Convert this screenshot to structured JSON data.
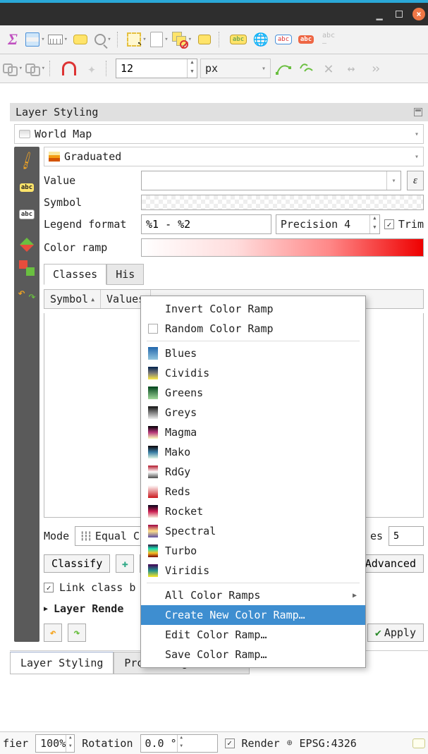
{
  "toolbar2": {
    "size_value": "12",
    "unit": "px"
  },
  "panel": {
    "title": "Layer Styling",
    "layer": "World Map",
    "renderer": "Graduated",
    "value_label": "Value",
    "symbol_label": "Symbol",
    "legend_label": "Legend format",
    "legend_value": "%1 - %2",
    "precision": "Precision 4",
    "trim_label": "Trim",
    "ramp_label": "Color ramp",
    "tabs": {
      "classes": "Classes",
      "histogram": "His"
    },
    "columns": {
      "symbol": "Symbol",
      "values": "Values"
    },
    "mode_label": "Mode",
    "mode_value": "Equal C",
    "classes_label": "es",
    "classes_value": "5",
    "classify": "Classify",
    "advanced": "Advanced",
    "link": "Link class b",
    "layer_rendering": "Layer Rende",
    "apply": "Apply"
  },
  "bottom_tabs": {
    "styling": "Layer Styling",
    "toolbox": "Processing Toolbox"
  },
  "status": {
    "field_label": "fier",
    "field_value": "100%",
    "rotation_label": "Rotation",
    "rotation_value": "0.0 °",
    "render": "Render",
    "crs": "EPSG:4326"
  },
  "menu": {
    "invert": "Invert Color Ramp",
    "random": "Random Color Ramp",
    "ramps": [
      "Blues",
      "Cividis",
      "Greens",
      "Greys",
      "Magma",
      "Mako",
      "RdGy",
      "Reds",
      "Rocket",
      "Spectral",
      "Turbo",
      "Viridis"
    ],
    "all": "All Color Ramps",
    "create": "Create New Color Ramp…",
    "edit": "Edit Color Ramp…",
    "save": "Save Color Ramp…"
  }
}
